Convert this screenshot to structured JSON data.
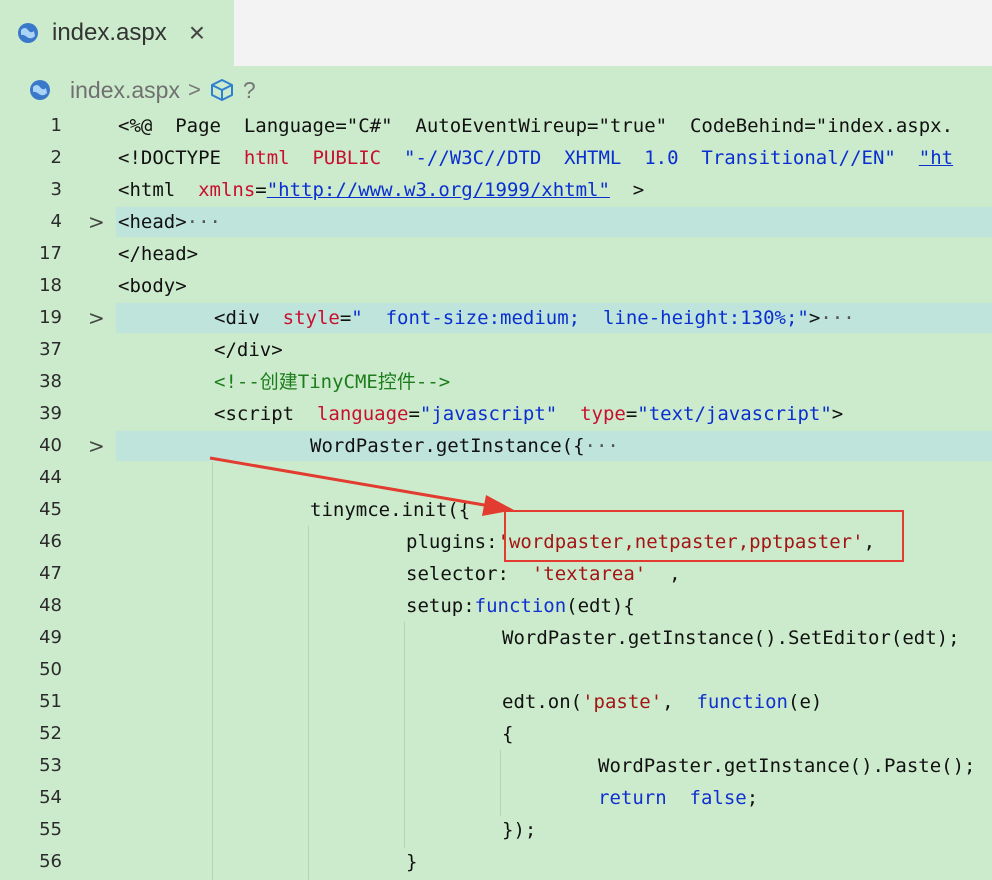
{
  "tab": {
    "label": "index.aspx",
    "close": "×",
    "icon": "globe-icon"
  },
  "breadcrumb": {
    "file": "index.aspx",
    "sep": ">",
    "symbol": "?",
    "icons": [
      "globe-icon",
      "cube-icon"
    ]
  },
  "colors": {
    "editor_bg": "#ccebcc",
    "fold_highlight": "#bfe4dc",
    "annotation_red": "#e23b30",
    "string_blue": "#0a2fd0",
    "attr_red": "#c8102e"
  },
  "lines": [
    {
      "num": "1",
      "tokens": [
        [
          "tag",
          "<%@  Page  "
        ],
        [
          "plain",
          "Language=\"C#\"  AutoEventWireup=\"true\"  CodeBehind=\"index.aspx."
        ]
      ]
    },
    {
      "num": "2",
      "tokens": [
        [
          "tag",
          "<!DOCTYPE  "
        ],
        [
          "attr",
          "html  PUBLIC  "
        ],
        [
          "str",
          "\"-//W3C//DTD  XHTML  1.0  Transitional//EN\"  "
        ],
        [
          "url",
          "\"ht"
        ]
      ]
    },
    {
      "num": "3",
      "tokens": [
        [
          "tag",
          "<html  "
        ],
        [
          "attr",
          "xmlns"
        ],
        [
          "plain",
          "="
        ],
        [
          "url",
          "\"http://www.w3.org/1999/xhtml\""
        ],
        [
          "tag",
          "  >"
        ]
      ]
    },
    {
      "num": "4",
      "fold": ">",
      "tokens": [
        [
          "tag",
          "<head>"
        ],
        [
          "ell",
          "···"
        ]
      ]
    },
    {
      "num": "17",
      "tokens": [
        [
          "tag",
          "</head>"
        ]
      ]
    },
    {
      "num": "18",
      "tokens": [
        [
          "tag",
          "<body>"
        ]
      ]
    },
    {
      "num": "19",
      "fold": ">",
      "tokens": [
        [
          "tag",
          "<div  "
        ],
        [
          "attr",
          "style"
        ],
        [
          "plain",
          "="
        ],
        [
          "str",
          "\"  font-size:medium;  line-height:130%;\""
        ],
        [
          "tag",
          ">"
        ],
        [
          "ell",
          "···"
        ]
      ]
    },
    {
      "num": "37",
      "tokens": [
        [
          "tag",
          "</div>"
        ]
      ]
    },
    {
      "num": "38",
      "tokens": [
        [
          "cmt",
          "<!--创建TinyCME控件-->"
        ]
      ]
    },
    {
      "num": "39",
      "tokens": [
        [
          "tag",
          "<script  "
        ],
        [
          "attr",
          "language"
        ],
        [
          "plain",
          "="
        ],
        [
          "str",
          "\"javascript\"  "
        ],
        [
          "attr",
          "type"
        ],
        [
          "plain",
          "="
        ],
        [
          "str",
          "\"text/javascript\""
        ],
        [
          "tag",
          ">"
        ]
      ]
    },
    {
      "num": "40",
      "fold": ">",
      "tokens": [
        [
          "plain",
          "WordPaster.getInstance({"
        ],
        [
          "ell",
          "···"
        ]
      ]
    },
    {
      "num": "44",
      "tokens": []
    },
    {
      "num": "45",
      "tokens": [
        [
          "plain",
          "tinymce.init({"
        ]
      ]
    },
    {
      "num": "46",
      "tokens": [
        [
          "plain",
          "plugins:"
        ],
        [
          "strred",
          "'wordpaster,netpaster,pptpaster'"
        ],
        [
          "plain",
          ","
        ]
      ]
    },
    {
      "num": "47",
      "tokens": [
        [
          "plain",
          "selector:  "
        ],
        [
          "strred",
          "'textarea'"
        ],
        [
          "plain",
          "  ,"
        ]
      ]
    },
    {
      "num": "48",
      "tokens": [
        [
          "plain",
          "setup:"
        ],
        [
          "kw",
          "function"
        ],
        [
          "plain",
          "(edt){"
        ]
      ]
    },
    {
      "num": "49",
      "tokens": [
        [
          "plain",
          "WordPaster.getInstance().SetEditor(edt);"
        ]
      ]
    },
    {
      "num": "50",
      "tokens": []
    },
    {
      "num": "51",
      "tokens": [
        [
          "plain",
          "edt.on("
        ],
        [
          "strred",
          "'paste'"
        ],
        [
          "plain",
          ",  "
        ],
        [
          "kw",
          "function"
        ],
        [
          "plain",
          "(e)"
        ]
      ]
    },
    {
      "num": "52",
      "tokens": [
        [
          "plain",
          "{"
        ]
      ]
    },
    {
      "num": "53",
      "tokens": [
        [
          "plain",
          "WordPaster.getInstance().Paste();"
        ]
      ]
    },
    {
      "num": "54",
      "tokens": [
        [
          "kw",
          "return  false"
        ],
        [
          "plain",
          ";"
        ]
      ]
    },
    {
      "num": "55",
      "tokens": [
        [
          "plain",
          "});"
        ]
      ]
    },
    {
      "num": "56",
      "tokens": [
        [
          "plain",
          "}"
        ]
      ]
    }
  ]
}
